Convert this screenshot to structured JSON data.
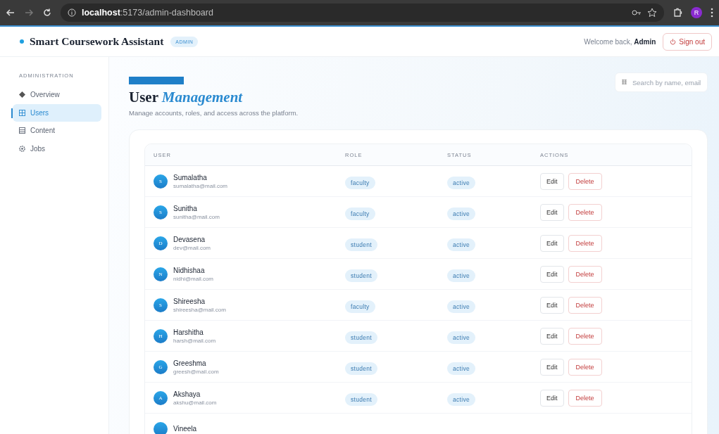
{
  "browser": {
    "url_host": "localhost",
    "url_path": ":5173/admin-dashboard",
    "profile": "R"
  },
  "header": {
    "brand": "Smart Coursework Assistant",
    "badge": "ADMIN",
    "welcome": "Welcome back, **Admin**",
    "sign_out": "Sign out"
  },
  "sidebar": {
    "heading": "ADMINISTRATION",
    "items": [
      {
        "label": "Overview",
        "selected": false
      },
      {
        "label": "Users",
        "selected": true
      },
      {
        "label": "Content",
        "selected": false
      },
      {
        "label": "Jobs",
        "selected": false
      }
    ]
  },
  "page": {
    "title": "User",
    "title_accent": "Management",
    "subtitle": "Manage accounts, roles, and access across the platform.",
    "search": {
      "placeholder": "Search by name, email"
    }
  },
  "table": {
    "columns": [
      "USER",
      "ROLE",
      "STATUS",
      "ACTIONS"
    ],
    "rows": [
      {
        "initial": "S",
        "name": "Sumalatha",
        "email": "sumalatha@mail.com",
        "role": "faculty",
        "status": "active",
        "edit": "Edit",
        "delete": "Delete"
      },
      {
        "initial": "S",
        "name": "Sunitha",
        "email": "sunitha@mail.com",
        "role": "faculty",
        "status": "active",
        "edit": "Edit",
        "delete": "Delete"
      },
      {
        "initial": "D",
        "name": "Devasena",
        "email": "dev@mail.com",
        "role": "student",
        "status": "active",
        "edit": "Edit",
        "delete": "Delete"
      },
      {
        "initial": "N",
        "name": "Nidhishaa",
        "email": "nidhi@mail.com",
        "role": "student",
        "status": "active",
        "edit": "Edit",
        "delete": "Delete"
      },
      {
        "initial": "S",
        "name": "Shireesha",
        "email": "shireesha@mail.com",
        "role": "faculty",
        "status": "active",
        "edit": "Edit",
        "delete": "Delete"
      },
      {
        "initial": "H",
        "name": "Harshitha",
        "email": "harsh@mail.com",
        "role": "student",
        "status": "active",
        "edit": "Edit",
        "delete": "Delete"
      },
      {
        "initial": "G",
        "name": "Greeshma",
        "email": "greesh@mail.com",
        "role": "student",
        "status": "active",
        "edit": "Edit",
        "delete": "Delete"
      },
      {
        "initial": "A",
        "name": "Akshaya",
        "email": "akshu@mail.com",
        "role": "student",
        "status": "active",
        "edit": "Edit",
        "delete": "Delete"
      },
      {
        "name": "Vineela"
      }
    ]
  }
}
